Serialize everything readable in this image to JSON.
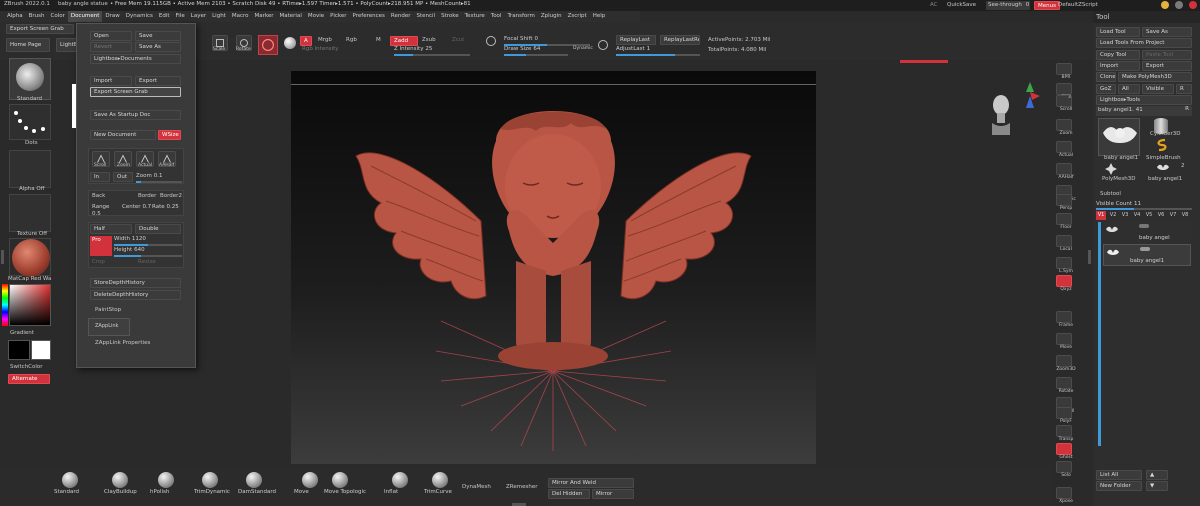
{
  "menubar": {
    "app_title": "ZBrush 2022.0.1",
    "doc_name": "baby angle statue",
    "stats": "• Free Mem 19.115GB • Active Mem 2103 • Scratch Disk 49 • RTime▸1.597 Timer▸1.571 • PolyCount▸218.951 MP • MeshCount▸81",
    "items": [
      "Alpha",
      "Brush",
      "Color",
      "Document",
      "Draw",
      "Dynamics",
      "Edit",
      "File",
      "Layer",
      "Light",
      "Macro",
      "Marker",
      "Material",
      "Movie",
      "Picker",
      "Preferences",
      "Render",
      "Stencil",
      "Stroke",
      "Texture",
      "Tool",
      "Transform",
      "Zplugin",
      "Zscript",
      "Help"
    ],
    "ac": "AC",
    "quicksave": "QuickSave",
    "seethrough": "See-through",
    "seethrough_value": "0",
    "menus": "Menus",
    "default_zscript": "DefaultZScript"
  },
  "top": {
    "export_screen_grab": "Export Screen Grab",
    "home_page": "Home Page",
    "lightbox": "LightBox",
    "scale": "Scale",
    "rotate": "Rotate",
    "a_btn": "A",
    "mrgb": "Mrgb",
    "rgb": "Rgb",
    "m": "M",
    "zadd": "Zadd",
    "zsub": "Zsub",
    "zcut": "Zcut",
    "rgb_intensity": "Rgb Intensity",
    "z_intensity": "Z Intensity",
    "z_intensity_value": "25",
    "focal_shift": "Focal Shift",
    "focal_shift_value": "0",
    "draw_size": "Draw Size",
    "draw_size_value": "64",
    "dynamic": "Dynamic",
    "replay_last": "ReplayLast",
    "replay_last_rel": "ReplayLastRel",
    "adjust_last": "AdjustLast",
    "adjust_last_value": "1",
    "active_points": "ActivePoints: 2.703 Mil",
    "total_points": "TotalPoints: 4.080 Mil"
  },
  "left_shelf": {
    "brush_label": "Standard",
    "stroke_label": "Dots",
    "alpha_label": "Alpha Off",
    "texture_label": "Texture Off",
    "material_label": "MatCap Red Wa",
    "gradient": "Gradient",
    "switch_color": "SwitchColor",
    "alternate": "Alternate"
  },
  "document_menu": {
    "open": "Open",
    "save": "Save",
    "revert": "Revert",
    "save_as": "Save As",
    "lightbox_documents": "Lightbox▸Documents",
    "import": "Import",
    "export": "Export",
    "export_screen_grab": "Export Screen Grab",
    "save_at_startup": "Save As Startup Doc",
    "new_document": "New Document",
    "wsize": "WSize",
    "scroll": "Scroll",
    "zoom": "Zoom",
    "actual": "Actual",
    "aahalf": "AAHalf",
    "in": "In",
    "out": "Out",
    "zoom_value_label": "Zoom",
    "zoom_value": "0.1",
    "back": "Back",
    "border": "Border",
    "border2": "Border2",
    "range": "Range",
    "range_value": "0.5",
    "center": "Center",
    "center_value": "0.7",
    "rate": "Rate",
    "rate_value": "0.25",
    "half": "Half",
    "double": "Double",
    "pro": "Pro",
    "width": "Width",
    "width_value": "1120",
    "height": "Height",
    "height_value": "640",
    "crop": "Crop",
    "resize": "Resize",
    "store_depth_history": "StoreDepthHistory",
    "delete_depth_history": "DeleteDepthHistory",
    "paintstop": "PaintStop",
    "zapplink": "ZAppLink",
    "zapplink_properties": "ZAppLink Properties"
  },
  "right_shelf": {
    "bpr": "BPR",
    "spix": "SPix",
    "spix_value": "3",
    "scroll": "Scroll",
    "zoom": "Zoom",
    "actual": "Actual",
    "aahalf": "AAHalf",
    "dynamic": "Dynamic",
    "persp": "Persp",
    "floor": "Floor",
    "local": "Local",
    "lsym": "L.Sym",
    "gxyz": "Qxyz",
    "frame": "Frame",
    "move": "Move",
    "zoom3d": "Zoom3D",
    "rotate": "Rotate",
    "line_fill": "Line Fill",
    "polyf": "PolyF",
    "transp": "Transp",
    "ghost": "Ghost",
    "solo": "Solo",
    "xpose": "Xpose"
  },
  "tool_panel": {
    "title": "Tool",
    "load_tool": "Load Tool",
    "save_as": "Save As",
    "load_from_project": "Load Tools From Project",
    "copy_tool": "Copy Tool",
    "paste_tool": "Paste Tool",
    "import": "Import",
    "export": "Export",
    "clone": "Clone",
    "make_polymesh": "Make PolyMesh3D",
    "goz": "GoZ",
    "all": "All",
    "visible": "Visible",
    "r": "R",
    "lightbox_tools": "Lightbox▸Tools",
    "current_tool": "baby angel1.",
    "current_tool_value": "41",
    "tools": [
      {
        "label": "baby angel1"
      },
      {
        "label": "Cylinder3D"
      },
      {
        "label": "SimpleBrush"
      },
      {
        "label": "PolyMesh3D"
      },
      {
        "label": "baby angel1"
      }
    ],
    "tool_count": "2",
    "subtool": "Subtool",
    "visible_count": "Visible Count",
    "visible_count_value": "11",
    "versions": [
      "V1",
      "V2",
      "V3",
      "V4",
      "V5",
      "V6",
      "V7",
      "V8"
    ],
    "subtools": [
      "baby angel",
      "baby angel1"
    ],
    "list_all": "List All",
    "new_folder": "New Folder"
  },
  "bottom": {
    "brushes": [
      "Standard",
      "ClayBuildup",
      "hPolish",
      "TrimDynamic",
      "DamStandard",
      "Move",
      "Move Topologic",
      "Inflat",
      "TrimCurve"
    ],
    "dynamesh": "DynaMesh",
    "zremesher": "ZRemesher",
    "mirror_and_weld": "Mirror And Weld",
    "del_hidden": "Del Hidden",
    "mirror": "Mirror"
  },
  "colors": {
    "accent_red": "#d2323c",
    "accent_blue": "#3e9ad8",
    "model": "#b95544"
  }
}
